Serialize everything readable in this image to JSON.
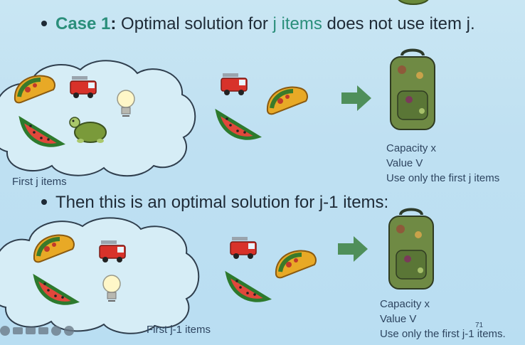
{
  "case1": {
    "prefix": "Case 1",
    "colon": ":",
    "text_a": " Optimal solution for ",
    "text_b": "j items",
    "text_c": " does not use item j."
  },
  "then": {
    "text": "Then this is an optimal solution for j-1 items:"
  },
  "top": {
    "cloud_label": "First j items",
    "cap": [
      "Capacity x",
      "Value V",
      "Use only the first j items"
    ]
  },
  "bottom": {
    "cloud_label": "First j-1 items",
    "cap": [
      "Capacity x",
      "Value V",
      "Use only the first j-1 items."
    ]
  },
  "slide_number": "71",
  "icons": [
    "taco-icon",
    "firetruck-icon",
    "lightbulb-icon",
    "watermelon-icon",
    "turtle-icon",
    "arrow-right-icon",
    "backpack-icon"
  ],
  "colors": {
    "accent": "#2b8f7b",
    "arrow": "#4f8f5a",
    "cloud_fill": "#d6edf6",
    "cloud_stroke": "#2f3e4d"
  }
}
